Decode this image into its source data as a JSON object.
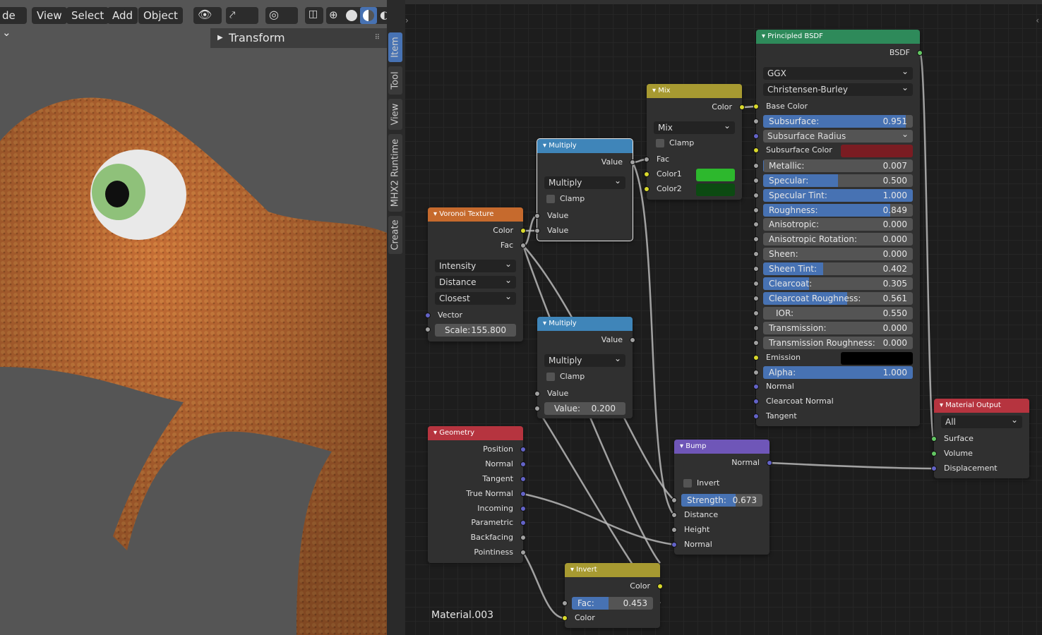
{
  "viewport": {
    "header": {
      "mode_label": "de",
      "view": "View",
      "select": "Select",
      "add": "Add",
      "object": "Object"
    },
    "transform_panel": "Transform",
    "sidebar_tabs": [
      "Item",
      "Tool",
      "View",
      "MHX2 Runtime",
      "Create"
    ]
  },
  "material_name": "Material.003",
  "nodes": {
    "principled": {
      "title": "Principled BSDF",
      "output": "BSDF",
      "distribution": "GGX",
      "subsurface_method": "Christensen-Burley",
      "base_color": "Base Color",
      "subsurface": {
        "label": "Subsurface:",
        "value": "0.951",
        "fill": 0.951
      },
      "subsurface_radius": "Subsurface Radius",
      "subsurface_color": {
        "label": "Subsurface Color",
        "color": "#7a1c22"
      },
      "metallic": {
        "label": "Metallic:",
        "value": "0.007",
        "fill": 0.007
      },
      "specular": {
        "label": "Specular:",
        "value": "0.500",
        "fill": 0.5
      },
      "specular_tint": {
        "label": "Specular Tint:",
        "value": "1.000",
        "fill": 1.0
      },
      "roughness": {
        "label": "Roughness:",
        "value": "0.849",
        "fill": 0.849
      },
      "anisotropic": {
        "label": "Anisotropic:",
        "value": "0.000",
        "fill": 0
      },
      "anisotropic_rotation": {
        "label": "Anisotropic Rotation:",
        "value": "0.000",
        "fill": 0
      },
      "sheen": {
        "label": "Sheen:",
        "value": "0.000",
        "fill": 0
      },
      "sheen_tint": {
        "label": "Sheen Tint:",
        "value": "0.402",
        "fill": 0.402
      },
      "clearcoat": {
        "label": "Clearcoat:",
        "value": "0.305",
        "fill": 0.305
      },
      "clearcoat_roughness": {
        "label": "Clearcoat Roughness:",
        "value": "0.561",
        "fill": 0.561
      },
      "ior": {
        "label": "IOR:",
        "value": "0.550"
      },
      "transmission": {
        "label": "Transmission:",
        "value": "0.000",
        "fill": 0
      },
      "transmission_roughness": {
        "label": "Transmission Roughness:",
        "value": "0.000",
        "fill": 0
      },
      "emission": {
        "label": "Emission",
        "color": "#000000"
      },
      "alpha": {
        "label": "Alpha:",
        "value": "1.000",
        "fill": 1.0
      },
      "normal": "Normal",
      "clearcoat_normal": "Clearcoat Normal",
      "tangent": "Tangent"
    },
    "mix": {
      "title": "Mix",
      "output": "Color",
      "blend": "Mix",
      "clamp": "Clamp",
      "fac": "Fac",
      "color1": "Color1",
      "color2": "Color2",
      "color1_value": "#2db82d",
      "color2_value": "#0c4a12"
    },
    "multiply1": {
      "title": "Multiply",
      "output": "Value",
      "op": "Multiply",
      "clamp": "Clamp",
      "in1": "Value",
      "in2": "Value"
    },
    "multiply2": {
      "title": "Multiply",
      "output": "Value",
      "op": "Multiply",
      "clamp": "Clamp",
      "in1": "Value",
      "value": {
        "label": "Value:",
        "value": "0.200"
      }
    },
    "voronoi": {
      "title": "Voronoi Texture",
      "out_color": "Color",
      "out_fac": "Fac",
      "coloring": "Intensity",
      "distance": "Distance",
      "feature": "Closest",
      "vector": "Vector",
      "scale": {
        "label": "Scale:",
        "value": "155.800"
      }
    },
    "geometry": {
      "title": "Geometry",
      "outputs": [
        "Position",
        "Normal",
        "Tangent",
        "True Normal",
        "Incoming",
        "Parametric",
        "Backfacing",
        "Pointiness"
      ]
    },
    "bump": {
      "title": "Bump",
      "output": "Normal",
      "invert": "Invert",
      "strength": {
        "label": "Strength:",
        "value": "0.673",
        "fill": 0.673
      },
      "distance": "Distance",
      "height": "Height",
      "normal": "Normal"
    },
    "invert": {
      "title": "Invert",
      "output": "Color",
      "fac": {
        "label": "Fac:",
        "value": "0.453",
        "fill": 0.453
      },
      "color": "Color"
    },
    "output": {
      "title": "Material Output",
      "target": "All",
      "surface": "Surface",
      "volume": "Volume",
      "displacement": "Displacement"
    }
  },
  "colors": {
    "header_texture": "#c66a2d",
    "header_math": "#3f85b9",
    "header_mix": "#a79a31",
    "header_shader": "#2e8a5a",
    "header_input": "#b6343f",
    "header_vector": "#6f56b8",
    "header_output": "#b6343f",
    "sock_color": "#d8d82c",
    "sock_float": "#a1a1a1",
    "sock_vector": "#6363c7",
    "sock_shader": "#63c763"
  }
}
